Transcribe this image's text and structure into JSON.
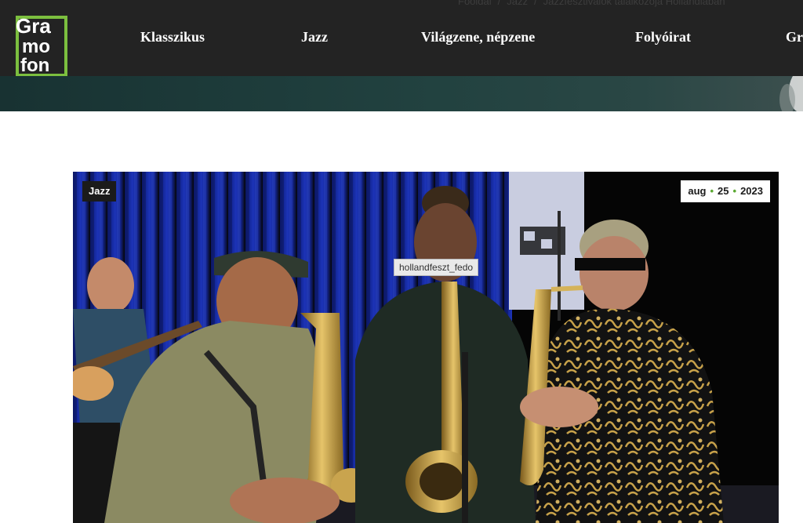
{
  "breadcrumb": [
    "Főoldal",
    "Jazz",
    "Jazzfesztiválok találkozója Hollandiában"
  ],
  "logo": {
    "line1": "Gra",
    "line2": "mo",
    "line3": "fon",
    "accent_color": "#7cbf3f"
  },
  "nav": {
    "items": [
      {
        "label": "Klasszikus"
      },
      {
        "label": "Jazz"
      },
      {
        "label": "Világzene, népzene"
      },
      {
        "label": "Folyóirat"
      },
      {
        "label": "Gr"
      }
    ]
  },
  "article": {
    "category": "Jazz",
    "date": {
      "month": "aug",
      "day": "25",
      "year": "2023"
    },
    "image_tooltip": "hollandfeszt_fedo"
  },
  "colors": {
    "header_bg": "#232323",
    "accent": "#5aa832"
  }
}
